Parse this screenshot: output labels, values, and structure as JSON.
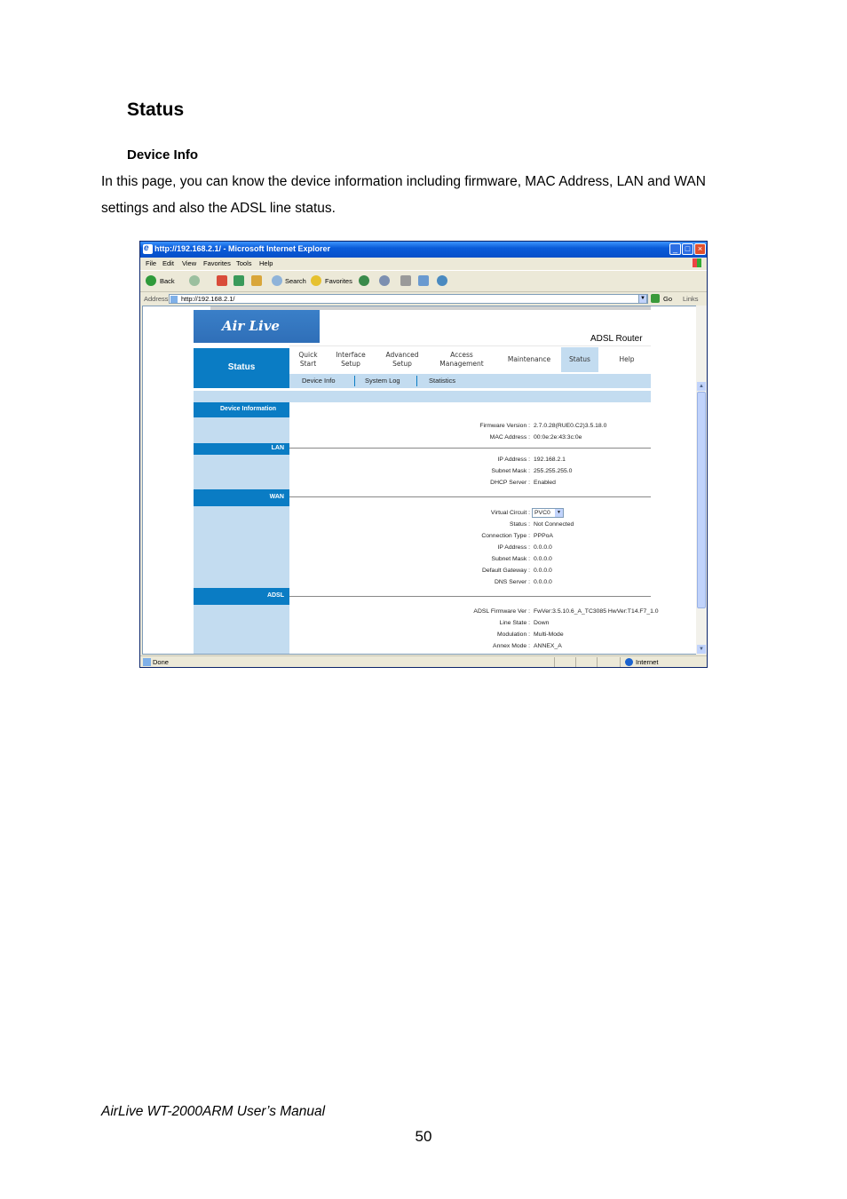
{
  "document": {
    "heading": "Status",
    "subheading": "Device Info",
    "paragraph_line1": "In this page, you can know the device information including firmware, MAC Address, LAN and WAN",
    "paragraph_line2": "settings and also the ADSL line status.",
    "footer_title": "AirLive WT-2000ARM User’s Manual",
    "page_number": "50"
  },
  "browser": {
    "title": "http://192.168.2.1/ - Microsoft Internet Explorer",
    "menu": [
      "File",
      "Edit",
      "View",
      "Favorites",
      "Tools",
      "Help"
    ],
    "toolbar": {
      "back": "Back",
      "search": "Search",
      "favorites": "Favorites"
    },
    "address_label": "Address",
    "address_value": "http://192.168.2.1/",
    "go_label": "Go",
    "links_label": "Links",
    "status_text": "Done",
    "zone_text": "Internet"
  },
  "router": {
    "logo_text": "Air Live",
    "product": "ADSL Router",
    "section_title": "Status",
    "nav": {
      "quick_start": "Quick Start",
      "interface_setup": "Interface Setup",
      "advanced_setup": "Advanced Setup",
      "access_management": "Access Management",
      "maintenance": "Maintenance",
      "status": "Status",
      "help": "Help"
    },
    "subnav": {
      "device_info": "Device Info",
      "system_log": "System Log",
      "statistics": "Statistics"
    },
    "device_information": {
      "header": "Device Information",
      "firmware_label": "Firmware Version :",
      "firmware_value": "2.7.0.28(RUE0.C2)3.5.18.0",
      "mac_label": "MAC Address :",
      "mac_value": "00:0e:2e:43:3c:0e"
    },
    "lan": {
      "header": "LAN",
      "ip_label": "IP Address :",
      "ip_value": "192.168.2.1",
      "mask_label": "Subnet Mask :",
      "mask_value": "255.255.255.0",
      "dhcp_label": "DHCP Server :",
      "dhcp_value": "Enabled"
    },
    "wan": {
      "header": "WAN",
      "vc_label": "Virtual Circuit :",
      "vc_value": "PVC0",
      "status_label": "Status :",
      "status_value": "Not Connected",
      "conn_label": "Connection Type :",
      "conn_value": "PPPoA",
      "ip_label": "IP Address :",
      "ip_value": "0.0.0.0",
      "mask_label": "Subnet Mask :",
      "mask_value": "0.0.0.0",
      "gw_label": "Default Gateway :",
      "gw_value": "0.0.0.0",
      "dns_label": "DNS Server :",
      "dns_value": "0.0.0.0"
    },
    "adsl": {
      "header": "ADSL",
      "fw_label": "ADSL Firmware Ver :",
      "fw_value": "FwVer:3.5.10.6_A_TC3085 HwVer:T14.F7_1.0",
      "line_label": "Line State :",
      "line_value": "Down",
      "mod_label": "Modulation :",
      "mod_value": "Multi-Mode",
      "annex_label": "Annex Mode :",
      "annex_value": "ANNEX_A"
    }
  }
}
